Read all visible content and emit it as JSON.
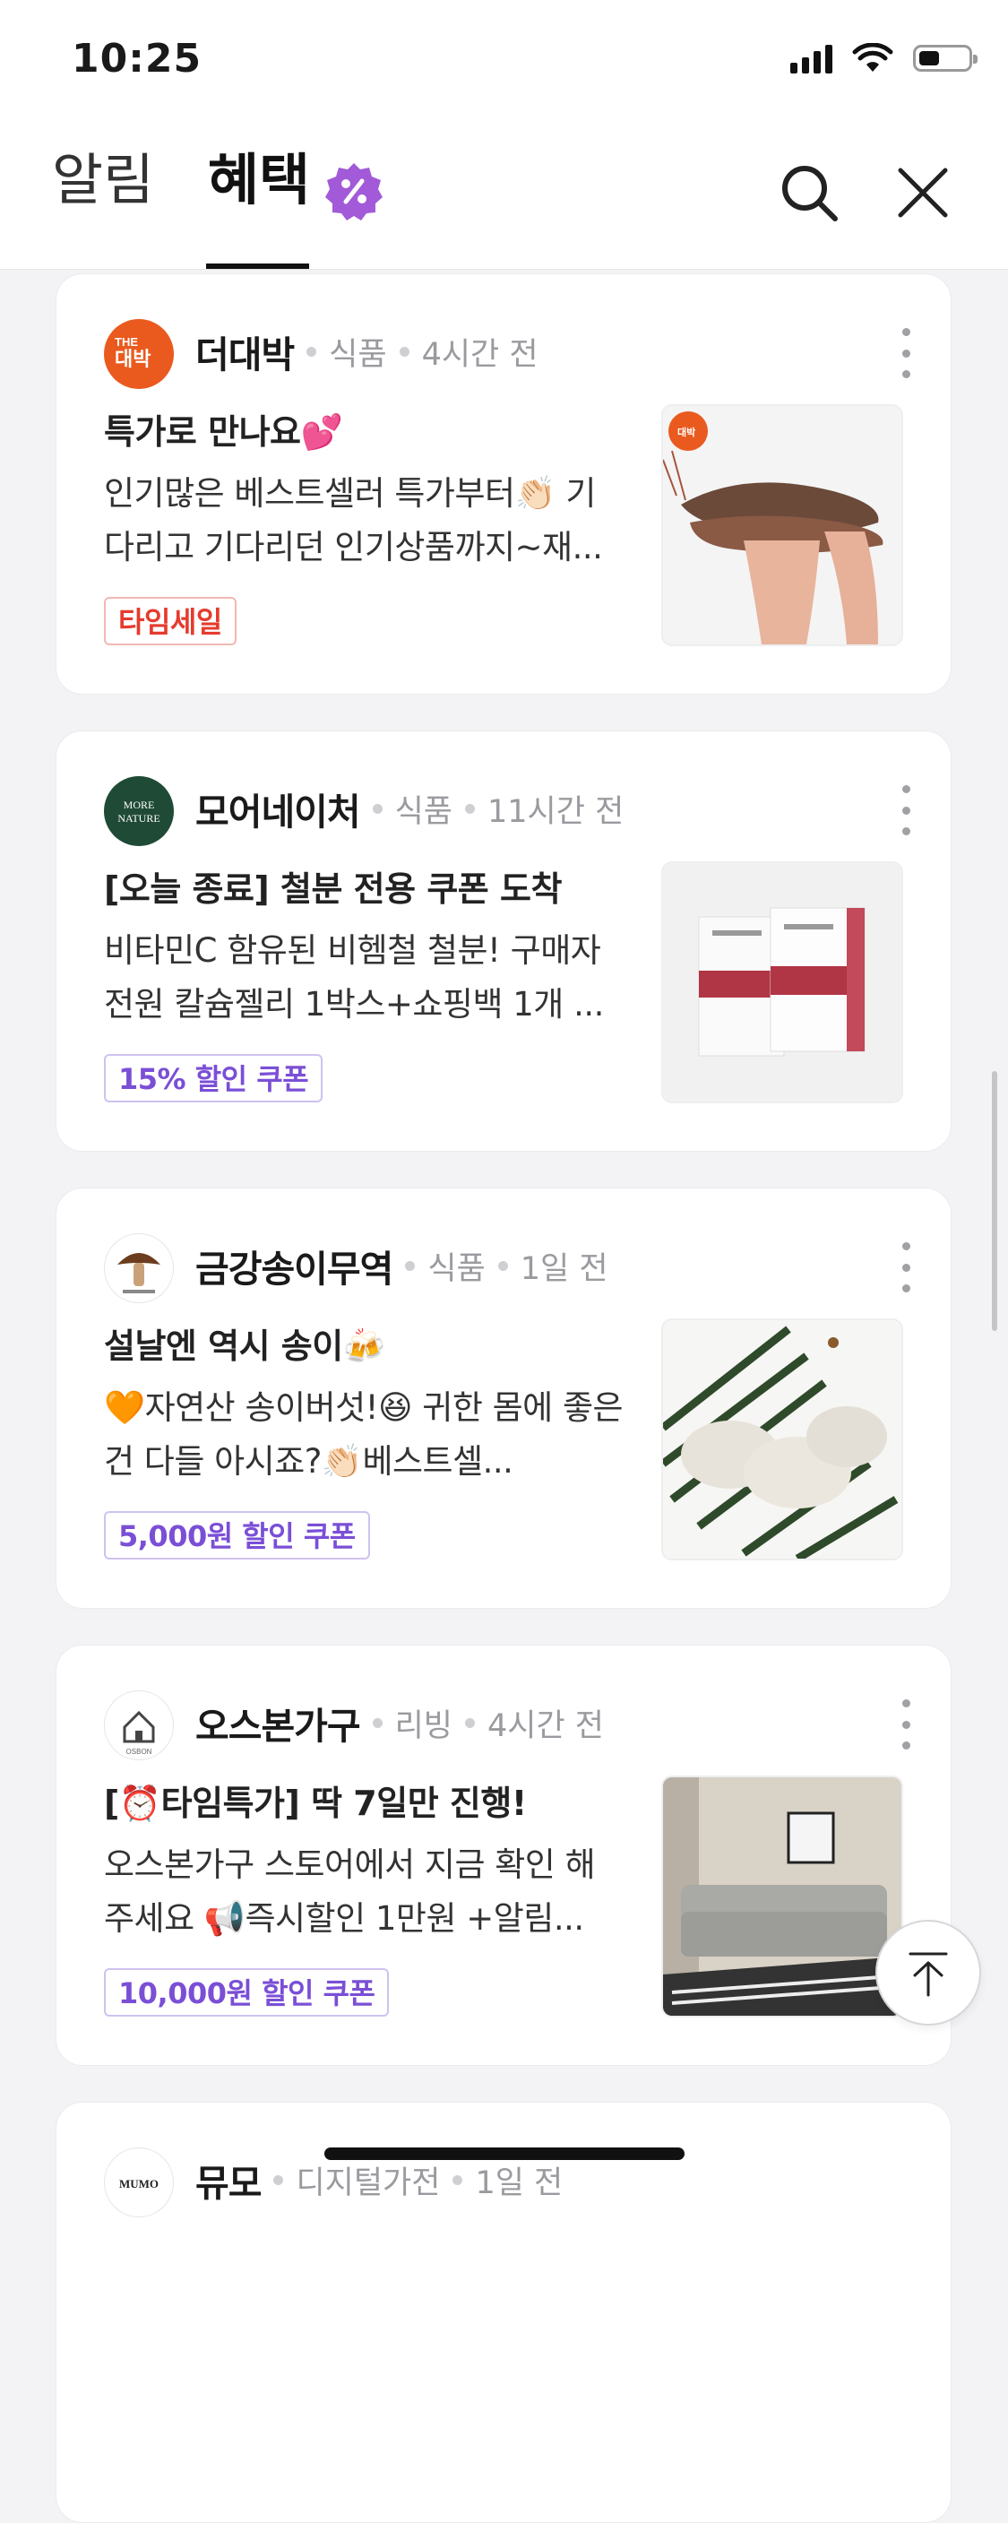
{
  "status": {
    "time": "10:25"
  },
  "header": {
    "tab_alarm": "알림",
    "tab_benefit": "혜택",
    "accent_color": "#a25ad9"
  },
  "cards": [
    {
      "store": "더대박",
      "logo_text": "THE 대박",
      "category": "식품",
      "time": "4시간 전",
      "title": "특가로 만나요💕",
      "description": "인기많은 베스트셀러 특가부터👏🏻 기다리고 기다리던 인기상품까지~재...",
      "tag": "타임세일",
      "tag_color": "red",
      "image": "shrimp-image"
    },
    {
      "store": "모어네이처",
      "logo_text": "MORE NATURE",
      "category": "식품",
      "time": "11시간 전",
      "title": "[오늘 종료] 철분 전용 쿠폰 도착",
      "description": "비타민C 함유된 비헴철 철분! 구매자 전원 칼슘젤리 1박스+쇼핑백 1개 ...",
      "tag": "15% 할인 쿠폰",
      "tag_color": "purple",
      "image": "supplement-box-image"
    },
    {
      "store": "금강송이무역",
      "logo_text": "금강송이무역",
      "category": "식품",
      "time": "1일 전",
      "title": "설날엔 역시 송이🍻",
      "description": "🧡자연산 송이버섯!😆 귀한 몸에 좋은 건 다들 아시죠?👏🏻베스트셀...",
      "tag": "5,000원 할인 쿠폰",
      "tag_color": "purple",
      "image": "mushroom-image"
    },
    {
      "store": "오스본가구",
      "logo_text": "OSBON",
      "category": "리빙",
      "time": "4시간 전",
      "title": "[⏰타임특가] 딱 7일만 진행!",
      "description": "오스본가구 스토어에서 지금 확인 해주세요 📢즉시할인 1만원 +알림...",
      "tag": "10,000원 할인 쿠폰",
      "tag_color": "purple",
      "image": "sofa-image"
    },
    {
      "store": "뮤모",
      "logo_text": "MUMO",
      "category": "디지털가전",
      "time": "1일 전"
    }
  ]
}
